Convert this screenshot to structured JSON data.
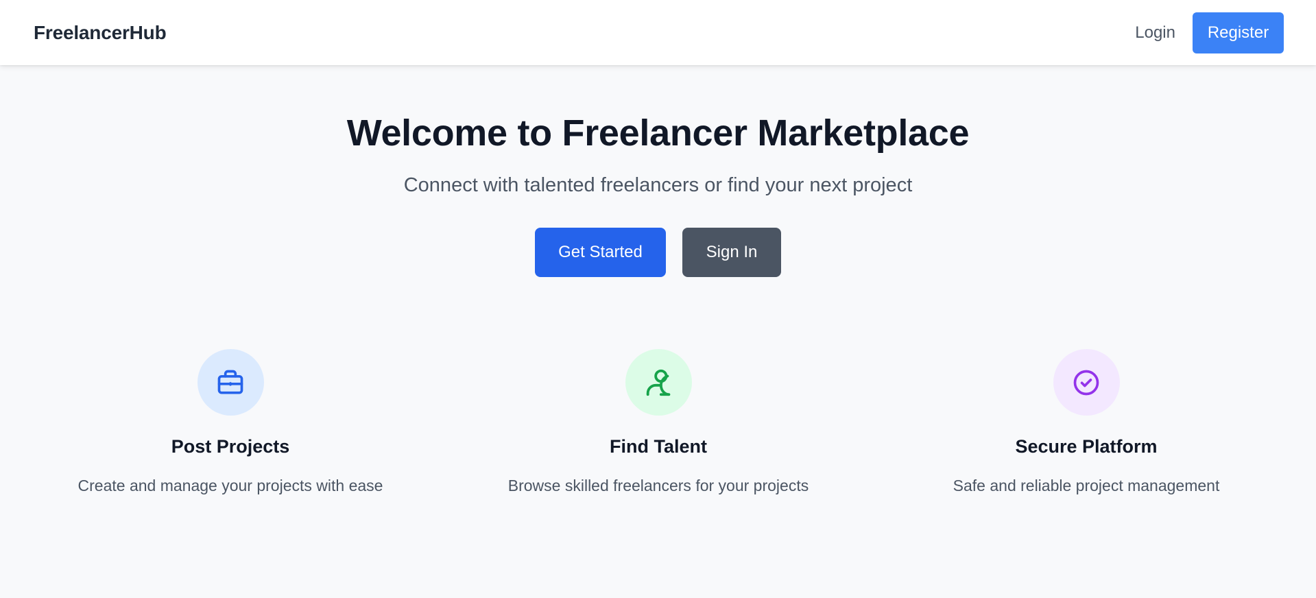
{
  "navbar": {
    "brand": "FreelancerHub",
    "login_label": "Login",
    "register_label": "Register"
  },
  "hero": {
    "title": "Welcome to Freelancer Marketplace",
    "subtitle": "Connect with talented freelancers or find your next project",
    "primary_button": "Get Started",
    "secondary_button": "Sign In"
  },
  "features": [
    {
      "icon": "briefcase-icon",
      "icon_color": "#2563eb",
      "icon_bg": "#dbeafe",
      "title": "Post Projects",
      "description": "Create and manage your projects with ease"
    },
    {
      "icon": "user-icon",
      "icon_color": "#16a34a",
      "icon_bg": "#dcfce7",
      "title": "Find Talent",
      "description": "Browse skilled freelancers for your projects"
    },
    {
      "icon": "check-circle-icon",
      "icon_color": "#9333ea",
      "icon_bg": "#f3e8ff",
      "title": "Secure Platform",
      "description": "Safe and reliable project management"
    }
  ],
  "colors": {
    "primary": "#2563eb",
    "register": "#3b82f6",
    "secondary": "#4b5563",
    "page_bg": "#f8f9fb"
  }
}
